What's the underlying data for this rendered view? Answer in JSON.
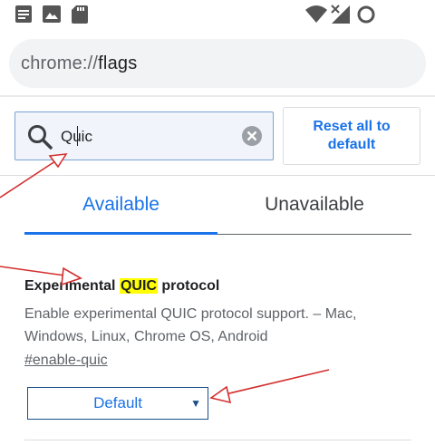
{
  "status_bar": {
    "icons": [
      "notes-icon",
      "image-icon",
      "sd-card-icon",
      "wifi-icon",
      "signal-icon",
      "sync-circle-icon"
    ]
  },
  "omnibox": {
    "scheme": "chrome://",
    "host": "flags"
  },
  "search": {
    "value": "Quic",
    "placeholder": ""
  },
  "reset_button": {
    "label": "Reset all to default"
  },
  "tabs": [
    {
      "label": "Available",
      "selected": true
    },
    {
      "label": "Unavailable",
      "selected": false
    }
  ],
  "flag": {
    "title_before": "Experimental ",
    "title_highlight": "QUIC",
    "title_after": " protocol",
    "description": "Enable experimental QUIC protocol support. – Mac, Windows, Linux, Chrome OS, Android",
    "link": "#enable-quic",
    "select_value": "Default"
  },
  "colors": {
    "accent": "#1a73e8",
    "highlight": "#ffff00",
    "annotation": "#d32f2f"
  }
}
